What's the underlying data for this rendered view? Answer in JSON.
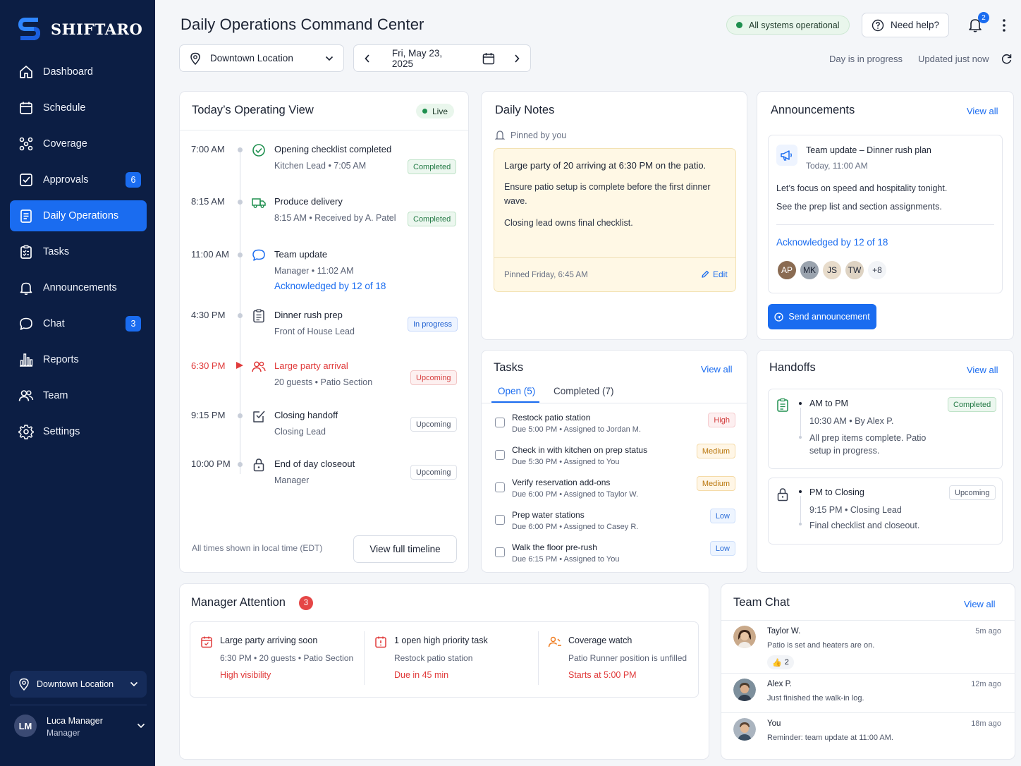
{
  "app": {
    "brand": "SHIFTARO",
    "accent": "#1a6cf0",
    "sidebar_bg": "#0c1e44"
  },
  "sidebar": {
    "items": [
      {
        "label": "Dashboard",
        "icon": "home-icon"
      },
      {
        "label": "Schedule",
        "icon": "calendar-icon"
      },
      {
        "label": "Coverage",
        "icon": "coverage-icon"
      },
      {
        "label": "Approvals",
        "icon": "check-square-icon",
        "badge": "6"
      },
      {
        "label": "Daily Operations",
        "icon": "clipboard-icon",
        "active": true
      },
      {
        "label": "Tasks",
        "icon": "task-list-icon"
      },
      {
        "label": "Announcements",
        "icon": "bell-icon"
      },
      {
        "label": "Chat",
        "icon": "chat-icon",
        "badge": "3"
      },
      {
        "label": "Reports",
        "icon": "bar-chart-icon"
      },
      {
        "label": "Team",
        "icon": "team-icon"
      },
      {
        "label": "Settings",
        "icon": "gear-icon"
      }
    ],
    "location": "Downtown Location",
    "user": {
      "initials": "LM",
      "name": "Luca Manager",
      "role": "Manager"
    }
  },
  "header": {
    "title": "Daily Operations Command Center",
    "status": "All systems operational",
    "help": "Need help?",
    "notifications_count": "2",
    "location": "Downtown Location",
    "date": "Fri, May 23, 2025",
    "day_status": "Day is in progress",
    "updated": "Updated just now"
  },
  "timeline": {
    "title": "Today’s Operating View",
    "live": "Live",
    "events": [
      {
        "time": "7:00 AM",
        "title": "Opening checklist completed",
        "sub": "Kitchen Lead • 7:05 AM",
        "status": "Completed"
      },
      {
        "time": "8:15 AM",
        "title": "Produce delivery",
        "sub": "8:15 AM • Received by A. Patel",
        "status": "Completed"
      },
      {
        "time": "11:00 AM",
        "title": "Team update",
        "sub": "Manager • 11:02 AM",
        "ack": "Acknowledged by 12 of 18"
      },
      {
        "time": "4:30 PM",
        "title": "Dinner rush prep",
        "sub": "Front of House Lead",
        "status": "In progress"
      },
      {
        "time": "6:30 PM",
        "title": "Large party arrival",
        "sub": "20 guests • Patio Section",
        "status": "Upcoming"
      },
      {
        "time": "9:15 PM",
        "title": "Closing handoff",
        "sub": "Closing Lead",
        "status": "Upcoming"
      },
      {
        "time": "10:00 PM",
        "title": "End of day closeout",
        "sub": "Manager",
        "status": "Upcoming"
      }
    ],
    "tz_note": "All times shown in local time (EDT)",
    "view_full": "View full timeline"
  },
  "notes": {
    "title": "Daily Notes",
    "pinned_by": "Pinned by you",
    "heading": "Large party of 20 arriving at 6:30 PM on the patio.",
    "p1": "Ensure patio setup is complete before the first dinner wave.",
    "p2": "Closing lead owns final checklist.",
    "footer": "Pinned Friday, 6:45 AM",
    "edit": "Edit"
  },
  "announcements": {
    "title": "Announcements",
    "view_all": "View all",
    "item": {
      "title": "Team update – Dinner rush plan",
      "date": "Today, 11:00 AM",
      "line1": "Let’s focus on speed and hospitality tonight.",
      "line2": "See the prep list and section assignments.",
      "ack": "Acknowledged by 12 of 18",
      "avatars": [
        "AP",
        "MK",
        "JS",
        "TW"
      ],
      "more": "+8"
    },
    "send": "Send announcement"
  },
  "tasks": {
    "title": "Tasks",
    "view_all": "View all",
    "tab_open": "Open (5)",
    "tab_completed": "Completed (7)",
    "items": [
      {
        "title": "Restock patio station",
        "sub": "Due 5:00 PM • Assigned to Jordan M.",
        "priority": "High"
      },
      {
        "title": "Check in with kitchen on prep status",
        "sub": "Due 5:30 PM • Assigned to You",
        "priority": "Medium"
      },
      {
        "title": "Verify reservation add-ons",
        "sub": "Due 6:00 PM • Assigned to Taylor W.",
        "priority": "Medium"
      },
      {
        "title": "Prep water stations",
        "sub": "Due 6:00 PM • Assigned to Casey R.",
        "priority": "Low"
      },
      {
        "title": "Walk the floor pre-rush",
        "sub": "Due 6:15 PM • Assigned to You",
        "priority": "Low"
      }
    ]
  },
  "handoffs": {
    "title": "Handoffs",
    "view_all": "View all",
    "items": [
      {
        "title": "AM to PM",
        "meta": "10:30 AM • By Alex P.",
        "note": "All prep items complete. Patio setup in progress.",
        "status": "Completed"
      },
      {
        "title": "PM to Closing",
        "meta": "9:15 PM • Closing Lead",
        "note": "Final checklist and closeout.",
        "status": "Upcoming"
      }
    ]
  },
  "attention": {
    "title": "Manager Attention",
    "count": "3",
    "items": [
      {
        "title": "Large party arriving soon",
        "sub": "6:30 PM • 20 guests • Patio Section",
        "alert": "High visibility"
      },
      {
        "title": "1 open high priority task",
        "sub": "Restock patio station",
        "alert": "Due in 45 min"
      },
      {
        "title": "Coverage watch",
        "sub": "Patio Runner position is unfilled",
        "alert": "Starts at 5:00 PM"
      }
    ]
  },
  "chat": {
    "title": "Team Chat",
    "view_all": "View all",
    "messages": [
      {
        "name": "Taylor W.",
        "text": "Patio is set and heaters are on.",
        "time": "5m ago",
        "reaction": "2"
      },
      {
        "name": "Alex P.",
        "text": "Just finished the walk-in log.",
        "time": "12m ago"
      },
      {
        "name": "You",
        "text": "Reminder: team update at 11:00 AM.",
        "time": "18m ago"
      }
    ]
  }
}
